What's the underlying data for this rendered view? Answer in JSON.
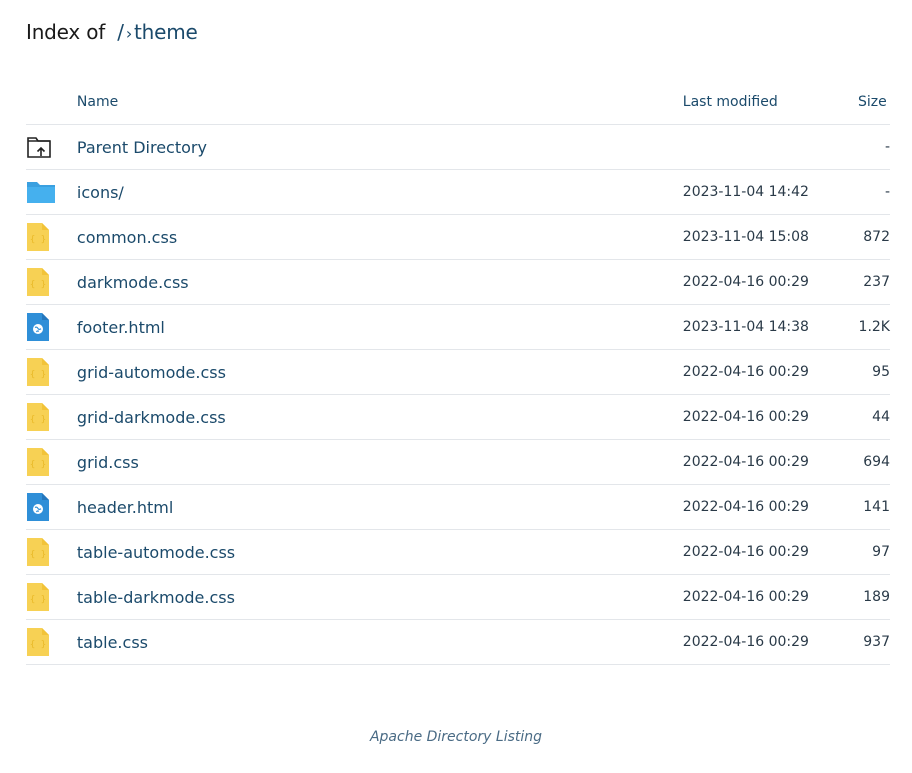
{
  "header": {
    "prefix": "Index of",
    "root": "/",
    "separator": "›",
    "current": "theme"
  },
  "columns": {
    "name": "Name",
    "last_modified": "Last modified",
    "size": "Size"
  },
  "rows": [
    {
      "icon": "parent-directory-icon",
      "name": "Parent Directory",
      "date": "",
      "size": "-"
    },
    {
      "icon": "folder-icon",
      "name": "icons/",
      "date": "2023-11-04 14:42",
      "size": "-"
    },
    {
      "icon": "css-file-icon",
      "name": "common.css",
      "date": "2023-11-04 15:08",
      "size": "872"
    },
    {
      "icon": "css-file-icon",
      "name": "darkmode.css",
      "date": "2022-04-16 00:29",
      "size": "237"
    },
    {
      "icon": "html-file-icon",
      "name": "footer.html",
      "date": "2023-11-04 14:38",
      "size": "1.2K"
    },
    {
      "icon": "css-file-icon",
      "name": "grid-automode.css",
      "date": "2022-04-16 00:29",
      "size": "95"
    },
    {
      "icon": "css-file-icon",
      "name": "grid-darkmode.css",
      "date": "2022-04-16 00:29",
      "size": "44"
    },
    {
      "icon": "css-file-icon",
      "name": "grid.css",
      "date": "2022-04-16 00:29",
      "size": "694"
    },
    {
      "icon": "html-file-icon",
      "name": "header.html",
      "date": "2022-04-16 00:29",
      "size": "141"
    },
    {
      "icon": "css-file-icon",
      "name": "table-automode.css",
      "date": "2022-04-16 00:29",
      "size": "97"
    },
    {
      "icon": "css-file-icon",
      "name": "table-darkmode.css",
      "date": "2022-04-16 00:29",
      "size": "189"
    },
    {
      "icon": "css-file-icon",
      "name": "table.css",
      "date": "2022-04-16 00:29",
      "size": "937"
    }
  ],
  "footer": {
    "text": "Apache Directory Listing"
  },
  "colors": {
    "link": "#1b4a6b",
    "folder": "#3aa0e0",
    "css_file": "#f7d154",
    "html_file": "#2f8fd8",
    "divider": "#e3e6ea"
  }
}
